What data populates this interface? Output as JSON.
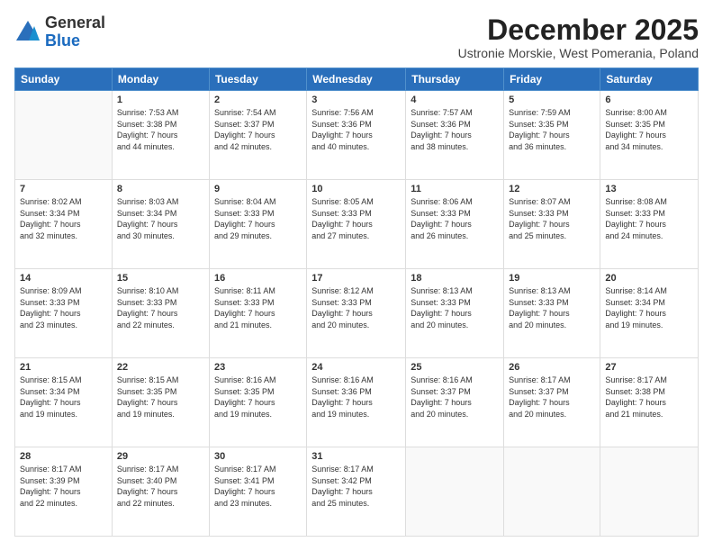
{
  "logo": {
    "general": "General",
    "blue": "Blue"
  },
  "title": "December 2025",
  "subtitle": "Ustronie Morskie, West Pomerania, Poland",
  "headers": [
    "Sunday",
    "Monday",
    "Tuesday",
    "Wednesday",
    "Thursday",
    "Friday",
    "Saturday"
  ],
  "weeks": [
    [
      {
        "day": "",
        "text": ""
      },
      {
        "day": "1",
        "text": "Sunrise: 7:53 AM\nSunset: 3:38 PM\nDaylight: 7 hours\nand 44 minutes."
      },
      {
        "day": "2",
        "text": "Sunrise: 7:54 AM\nSunset: 3:37 PM\nDaylight: 7 hours\nand 42 minutes."
      },
      {
        "day": "3",
        "text": "Sunrise: 7:56 AM\nSunset: 3:36 PM\nDaylight: 7 hours\nand 40 minutes."
      },
      {
        "day": "4",
        "text": "Sunrise: 7:57 AM\nSunset: 3:36 PM\nDaylight: 7 hours\nand 38 minutes."
      },
      {
        "day": "5",
        "text": "Sunrise: 7:59 AM\nSunset: 3:35 PM\nDaylight: 7 hours\nand 36 minutes."
      },
      {
        "day": "6",
        "text": "Sunrise: 8:00 AM\nSunset: 3:35 PM\nDaylight: 7 hours\nand 34 minutes."
      }
    ],
    [
      {
        "day": "7",
        "text": "Sunrise: 8:02 AM\nSunset: 3:34 PM\nDaylight: 7 hours\nand 32 minutes."
      },
      {
        "day": "8",
        "text": "Sunrise: 8:03 AM\nSunset: 3:34 PM\nDaylight: 7 hours\nand 30 minutes."
      },
      {
        "day": "9",
        "text": "Sunrise: 8:04 AM\nSunset: 3:33 PM\nDaylight: 7 hours\nand 29 minutes."
      },
      {
        "day": "10",
        "text": "Sunrise: 8:05 AM\nSunset: 3:33 PM\nDaylight: 7 hours\nand 27 minutes."
      },
      {
        "day": "11",
        "text": "Sunrise: 8:06 AM\nSunset: 3:33 PM\nDaylight: 7 hours\nand 26 minutes."
      },
      {
        "day": "12",
        "text": "Sunrise: 8:07 AM\nSunset: 3:33 PM\nDaylight: 7 hours\nand 25 minutes."
      },
      {
        "day": "13",
        "text": "Sunrise: 8:08 AM\nSunset: 3:33 PM\nDaylight: 7 hours\nand 24 minutes."
      }
    ],
    [
      {
        "day": "14",
        "text": "Sunrise: 8:09 AM\nSunset: 3:33 PM\nDaylight: 7 hours\nand 23 minutes."
      },
      {
        "day": "15",
        "text": "Sunrise: 8:10 AM\nSunset: 3:33 PM\nDaylight: 7 hours\nand 22 minutes."
      },
      {
        "day": "16",
        "text": "Sunrise: 8:11 AM\nSunset: 3:33 PM\nDaylight: 7 hours\nand 21 minutes."
      },
      {
        "day": "17",
        "text": "Sunrise: 8:12 AM\nSunset: 3:33 PM\nDaylight: 7 hours\nand 20 minutes."
      },
      {
        "day": "18",
        "text": "Sunrise: 8:13 AM\nSunset: 3:33 PM\nDaylight: 7 hours\nand 20 minutes."
      },
      {
        "day": "19",
        "text": "Sunrise: 8:13 AM\nSunset: 3:33 PM\nDaylight: 7 hours\nand 20 minutes."
      },
      {
        "day": "20",
        "text": "Sunrise: 8:14 AM\nSunset: 3:34 PM\nDaylight: 7 hours\nand 19 minutes."
      }
    ],
    [
      {
        "day": "21",
        "text": "Sunrise: 8:15 AM\nSunset: 3:34 PM\nDaylight: 7 hours\nand 19 minutes."
      },
      {
        "day": "22",
        "text": "Sunrise: 8:15 AM\nSunset: 3:35 PM\nDaylight: 7 hours\nand 19 minutes."
      },
      {
        "day": "23",
        "text": "Sunrise: 8:16 AM\nSunset: 3:35 PM\nDaylight: 7 hours\nand 19 minutes."
      },
      {
        "day": "24",
        "text": "Sunrise: 8:16 AM\nSunset: 3:36 PM\nDaylight: 7 hours\nand 19 minutes."
      },
      {
        "day": "25",
        "text": "Sunrise: 8:16 AM\nSunset: 3:37 PM\nDaylight: 7 hours\nand 20 minutes."
      },
      {
        "day": "26",
        "text": "Sunrise: 8:17 AM\nSunset: 3:37 PM\nDaylight: 7 hours\nand 20 minutes."
      },
      {
        "day": "27",
        "text": "Sunrise: 8:17 AM\nSunset: 3:38 PM\nDaylight: 7 hours\nand 21 minutes."
      }
    ],
    [
      {
        "day": "28",
        "text": "Sunrise: 8:17 AM\nSunset: 3:39 PM\nDaylight: 7 hours\nand 22 minutes."
      },
      {
        "day": "29",
        "text": "Sunrise: 8:17 AM\nSunset: 3:40 PM\nDaylight: 7 hours\nand 22 minutes."
      },
      {
        "day": "30",
        "text": "Sunrise: 8:17 AM\nSunset: 3:41 PM\nDaylight: 7 hours\nand 23 minutes."
      },
      {
        "day": "31",
        "text": "Sunrise: 8:17 AM\nSunset: 3:42 PM\nDaylight: 7 hours\nand 25 minutes."
      },
      {
        "day": "",
        "text": ""
      },
      {
        "day": "",
        "text": ""
      },
      {
        "day": "",
        "text": ""
      }
    ]
  ]
}
